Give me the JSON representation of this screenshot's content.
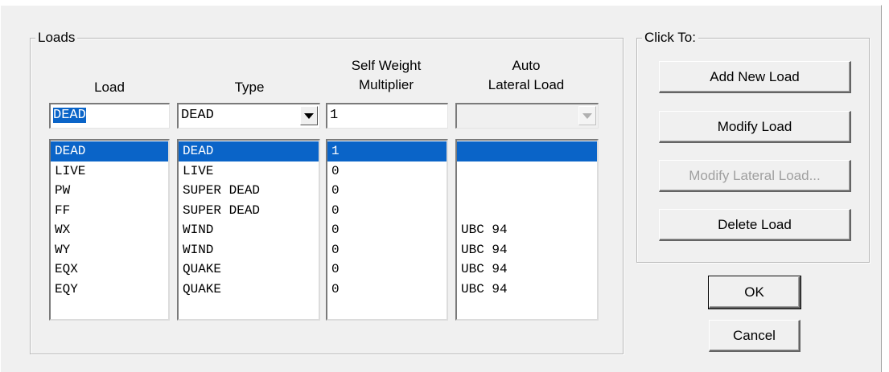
{
  "loads_group": {
    "title": "Loads",
    "headers": {
      "load": "Load",
      "type": "Type",
      "self_weight_line1": "Self Weight",
      "self_weight_line2": "Multiplier",
      "auto_line1": "Auto",
      "auto_line2": "Lateral Load"
    },
    "edit": {
      "load_value": "DEAD",
      "type_value": "DEAD",
      "multiplier_value": "1",
      "auto_lateral_value": ""
    },
    "rows": [
      {
        "load": "DEAD",
        "type": "DEAD",
        "multiplier": "1",
        "auto": "",
        "selected": true
      },
      {
        "load": "LIVE",
        "type": "LIVE",
        "multiplier": "0",
        "auto": ""
      },
      {
        "load": "PW",
        "type": "SUPER DEAD",
        "multiplier": "0",
        "auto": ""
      },
      {
        "load": "FF",
        "type": "SUPER DEAD",
        "multiplier": "0",
        "auto": ""
      },
      {
        "load": "WX",
        "type": "WIND",
        "multiplier": "0",
        "auto": "UBC 94"
      },
      {
        "load": "WY",
        "type": "WIND",
        "multiplier": "0",
        "auto": "UBC 94"
      },
      {
        "load": "EQX",
        "type": "QUAKE",
        "multiplier": "0",
        "auto": "UBC 94"
      },
      {
        "load": "EQY",
        "type": "QUAKE",
        "multiplier": "0",
        "auto": "UBC 94"
      }
    ]
  },
  "click_group": {
    "title": "Click To:",
    "add_new_load": "Add New Load",
    "modify_load": "Modify Load",
    "modify_lateral_load": "Modify Lateral Load...",
    "delete_load": "Delete Load"
  },
  "ok_label": "OK",
  "cancel_label": "Cancel",
  "colors": {
    "selection": "#0a64c8",
    "dialog_bg": "#f0f0f0"
  }
}
